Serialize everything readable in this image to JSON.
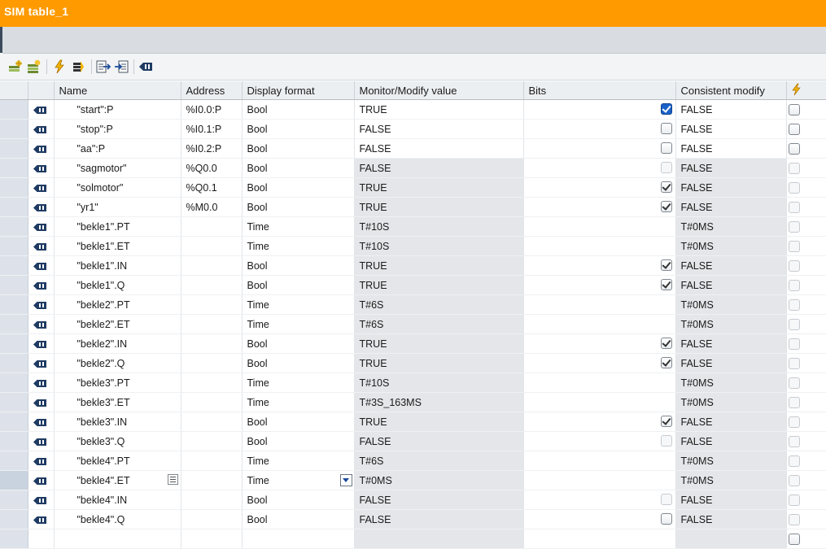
{
  "window": {
    "title": "SIM table_1"
  },
  "toolbar": {
    "buttons": [
      "add-row-icon",
      "insert-row-icon",
      "modify-now-icon",
      "modify-trigger-icon",
      "export-icon",
      "import-icon",
      "tag-icon"
    ]
  },
  "table": {
    "headers": {
      "name": "Name",
      "address": "Address",
      "display_format": "Display format",
      "monitor_value": "Monitor/Modify value",
      "bits": "Bits",
      "consistent_modify": "Consistent modify"
    },
    "rows": [
      {
        "name": "\"start\":P",
        "address": "%I0.0:P",
        "format": "Bool",
        "value": "TRUE",
        "bits": "checked-blue",
        "consistent": "FALSE",
        "flash": "enabled"
      },
      {
        "name": "\"stop\":P",
        "address": "%I0.1:P",
        "format": "Bool",
        "value": "FALSE",
        "bits": "unchecked",
        "consistent": "FALSE",
        "flash": "enabled"
      },
      {
        "name": "\"aa\":P",
        "address": "%I0.2:P",
        "format": "Bool",
        "value": "FALSE",
        "bits": "unchecked",
        "consistent": "FALSE",
        "flash": "enabled"
      },
      {
        "name": "\"sagmotor\"",
        "address": "%Q0.0",
        "format": "Bool",
        "value": "FALSE",
        "bits": "dim",
        "consistent": "FALSE",
        "flash": "dim"
      },
      {
        "name": "\"solmotor\"",
        "address": "%Q0.1",
        "format": "Bool",
        "value": "TRUE",
        "bits": "checked",
        "consistent": "FALSE",
        "flash": "dim"
      },
      {
        "name": "\"yr1\"",
        "address": "%M0.0",
        "format": "Bool",
        "value": "TRUE",
        "bits": "checked",
        "consistent": "FALSE",
        "flash": "dim"
      },
      {
        "name": "\"bekle1\".PT",
        "address": "",
        "format": "Time",
        "value": "T#10S",
        "bits": "",
        "consistent": "T#0MS",
        "flash": "dim"
      },
      {
        "name": "\"bekle1\".ET",
        "address": "",
        "format": "Time",
        "value": "T#10S",
        "bits": "",
        "consistent": "T#0MS",
        "flash": "dim"
      },
      {
        "name": "\"bekle1\".IN",
        "address": "",
        "format": "Bool",
        "value": "TRUE",
        "bits": "checked",
        "consistent": "FALSE",
        "flash": "dim"
      },
      {
        "name": "\"bekle1\".Q",
        "address": "",
        "format": "Bool",
        "value": "TRUE",
        "bits": "checked",
        "consistent": "FALSE",
        "flash": "dim"
      },
      {
        "name": "\"bekle2\".PT",
        "address": "",
        "format": "Time",
        "value": "T#6S",
        "bits": "",
        "consistent": "T#0MS",
        "flash": "dim"
      },
      {
        "name": "\"bekle2\".ET",
        "address": "",
        "format": "Time",
        "value": "T#6S",
        "bits": "",
        "consistent": "T#0MS",
        "flash": "dim"
      },
      {
        "name": "\"bekle2\".IN",
        "address": "",
        "format": "Bool",
        "value": "TRUE",
        "bits": "checked",
        "consistent": "FALSE",
        "flash": "dim"
      },
      {
        "name": "\"bekle2\".Q",
        "address": "",
        "format": "Bool",
        "value": "TRUE",
        "bits": "checked",
        "consistent": "FALSE",
        "flash": "dim"
      },
      {
        "name": "\"bekle3\".PT",
        "address": "",
        "format": "Time",
        "value": "T#10S",
        "bits": "",
        "consistent": "T#0MS",
        "flash": "dim"
      },
      {
        "name": "\"bekle3\".ET",
        "address": "",
        "format": "Time",
        "value": "T#3S_163MS",
        "bits": "",
        "consistent": "T#0MS",
        "flash": "dim"
      },
      {
        "name": "\"bekle3\".IN",
        "address": "",
        "format": "Bool",
        "value": "TRUE",
        "bits": "checked",
        "consistent": "FALSE",
        "flash": "dim"
      },
      {
        "name": "\"bekle3\".Q",
        "address": "",
        "format": "Bool",
        "value": "FALSE",
        "bits": "dim",
        "consistent": "FALSE",
        "flash": "dim"
      },
      {
        "name": "\"bekle4\".PT",
        "address": "",
        "format": "Time",
        "value": "T#6S",
        "bits": "",
        "consistent": "T#0MS",
        "flash": "dim"
      },
      {
        "name": "\"bekle4\".ET",
        "address": "",
        "format": "Time",
        "value": "T#0MS",
        "bits": "",
        "consistent": "T#0MS",
        "flash": "dim",
        "active": true
      },
      {
        "name": "\"bekle4\".IN",
        "address": "",
        "format": "Bool",
        "value": "FALSE",
        "bits": "dim",
        "consistent": "FALSE",
        "flash": "dim"
      },
      {
        "name": "\"bekle4\".Q",
        "address": "",
        "format": "Bool",
        "value": "FALSE",
        "bits": "unchecked",
        "consistent": "FALSE",
        "flash": "dim"
      }
    ]
  },
  "colors": {
    "title_bar": "#ff9a00",
    "checked_blue": "#1a62c9"
  }
}
